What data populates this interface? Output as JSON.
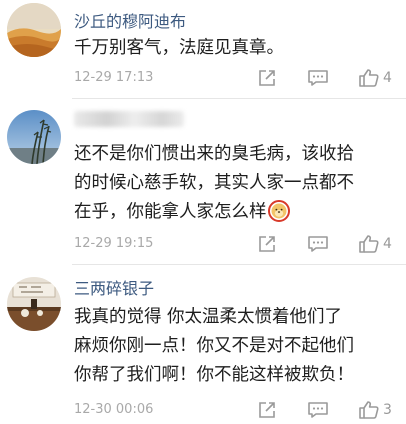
{
  "comments": [
    {
      "username": "沙丘的穆阿迪布",
      "lines": [
        "千万别客气，法庭见真章。"
      ],
      "time": "12-29 17:13",
      "likes": "4",
      "avatar": "desert-dune-avatar"
    },
    {
      "username": "",
      "username_blurred": true,
      "lines": [
        "还不是你们惯出来的臭毛病，该收拾",
        "的时候心慈手软，其实人家一点都不",
        "在乎，你能拿人家怎么样"
      ],
      "emoji": "doge-emoji",
      "time": "12-29 19:15",
      "likes": "4",
      "avatar": "reeds-and-sky-avatar"
    },
    {
      "username": "三两碎银子",
      "lines": [
        "我真的觉得 你太温柔太惯着他们了",
        "麻烦你刚一点！你又不是对不起他们",
        "你帮了我们啊！你不能这样被欺负！"
      ],
      "time": "12-30 00:06",
      "likes": "3",
      "avatar": "tea-table-avatar"
    }
  ],
  "icons": {
    "share": "share-icon",
    "reply": "comment-icon",
    "like": "thumbs-up-icon"
  },
  "colors": {
    "username": "#3d5a80",
    "emoji_highlight": "#d83a2a",
    "meta": "#a9a9a9"
  }
}
